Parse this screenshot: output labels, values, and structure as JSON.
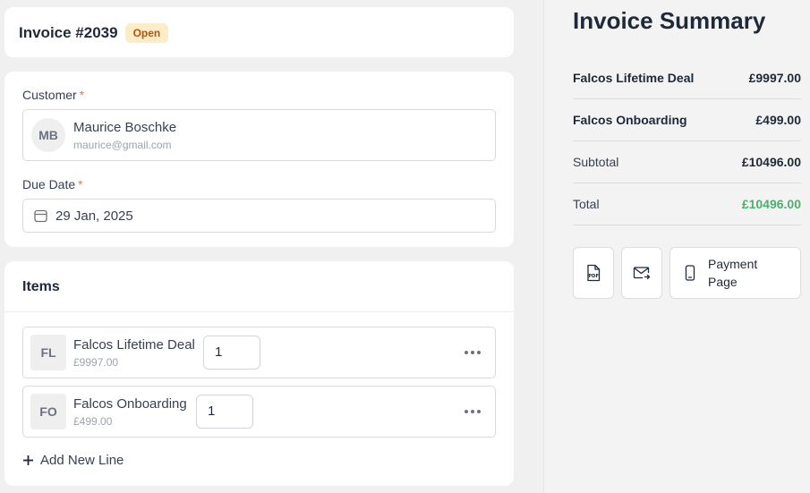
{
  "invoice": {
    "title": "Invoice #2039",
    "status": "Open"
  },
  "customer": {
    "label": "Customer",
    "required_mark": "*",
    "initials": "MB",
    "name": "Maurice Boschke",
    "email": "maurice@gmail.com"
  },
  "due_date": {
    "label": "Due Date",
    "required_mark": "*",
    "value": "29 Jan, 2025",
    "icon": "calendar-icon"
  },
  "items": {
    "title": "Items",
    "rows": [
      {
        "initials": "FL",
        "name": "Falcos Lifetime Deal",
        "price": "£9997.00",
        "quantity": "1"
      },
      {
        "initials": "FO",
        "name": "Falcos Onboarding",
        "price": "£499.00",
        "quantity": "1"
      }
    ],
    "add_label": "Add New Line"
  },
  "summary": {
    "title": "Invoice Summary",
    "lines": [
      {
        "label": "Falcos Lifetime Deal",
        "amount": "£9997.00"
      },
      {
        "label": "Falcos Onboarding",
        "amount": "£499.00"
      },
      {
        "label": "Subtotal",
        "amount": "£10496.00"
      },
      {
        "label": "Total",
        "amount": "£10496.00"
      }
    ],
    "total_color": "#4caf6e"
  },
  "actions": {
    "pdf_icon_text": "PDF",
    "payment_page_label": "Payment Page"
  }
}
